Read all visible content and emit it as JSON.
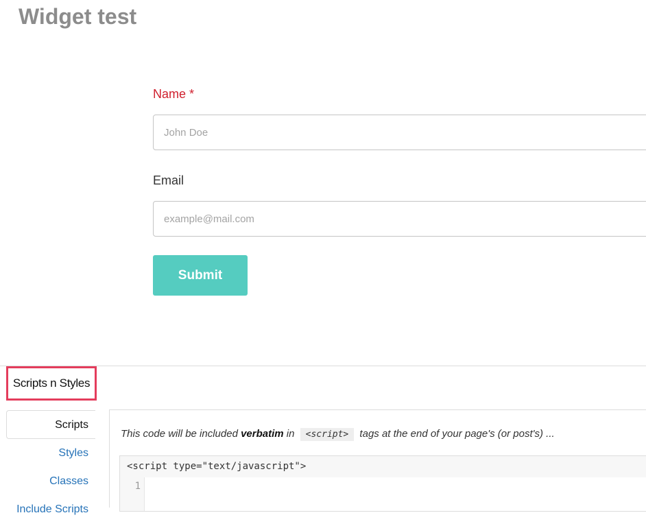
{
  "page": {
    "title": "Widget test"
  },
  "form": {
    "name": {
      "label": "Name *",
      "placeholder": "John Doe"
    },
    "email": {
      "label": "Email",
      "placeholder": "example@mail.com"
    },
    "submit_label": "Submit"
  },
  "scripts_panel": {
    "title": "Scripts n Styles",
    "tabs": [
      {
        "label": "Scripts",
        "active": true
      },
      {
        "label": "Styles",
        "active": false
      },
      {
        "label": "Classes",
        "active": false
      },
      {
        "label": "Include Scripts",
        "active": false
      }
    ],
    "description": {
      "prefix": "This code will be included ",
      "emphasis": "verbatim",
      "middle": " in ",
      "tag": "<script>",
      "suffix": " tags at the end of your page's (or post's) ..."
    },
    "code_header": "<script type=\"text/javascript\">",
    "line_number": "1"
  },
  "colors": {
    "accent": "#55ccc0",
    "required_label": "#d0202e",
    "highlight_border": "#e43c5c",
    "link": "#2673b8"
  }
}
